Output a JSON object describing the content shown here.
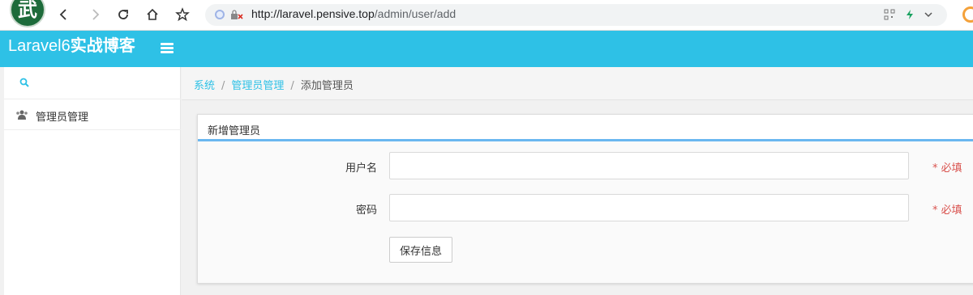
{
  "browser": {
    "favicon_text": "武",
    "url_host": "http://laravel.pensive.top",
    "url_path": "/admin/user/add"
  },
  "header": {
    "brand_prefix": "Laravel6",
    "brand_suffix": "实战博客"
  },
  "sidebar": {
    "search_icon": "search-icon",
    "items": [
      {
        "label": "管理员管理",
        "icon": "users-icon"
      }
    ]
  },
  "breadcrumb": {
    "items": [
      "系统",
      "管理员管理"
    ],
    "current": "添加管理员",
    "separator": "/"
  },
  "panel": {
    "title": "新增管理员",
    "fields": [
      {
        "label": "用户名",
        "value": "",
        "required_text": "* 必填"
      },
      {
        "label": "密码",
        "value": "",
        "required_text": "* 必填"
      }
    ],
    "submit_label": "保存信息"
  },
  "colors": {
    "accent": "#2ec1e6",
    "panel_border": "#6ab7f0",
    "required": "#d9534f"
  }
}
